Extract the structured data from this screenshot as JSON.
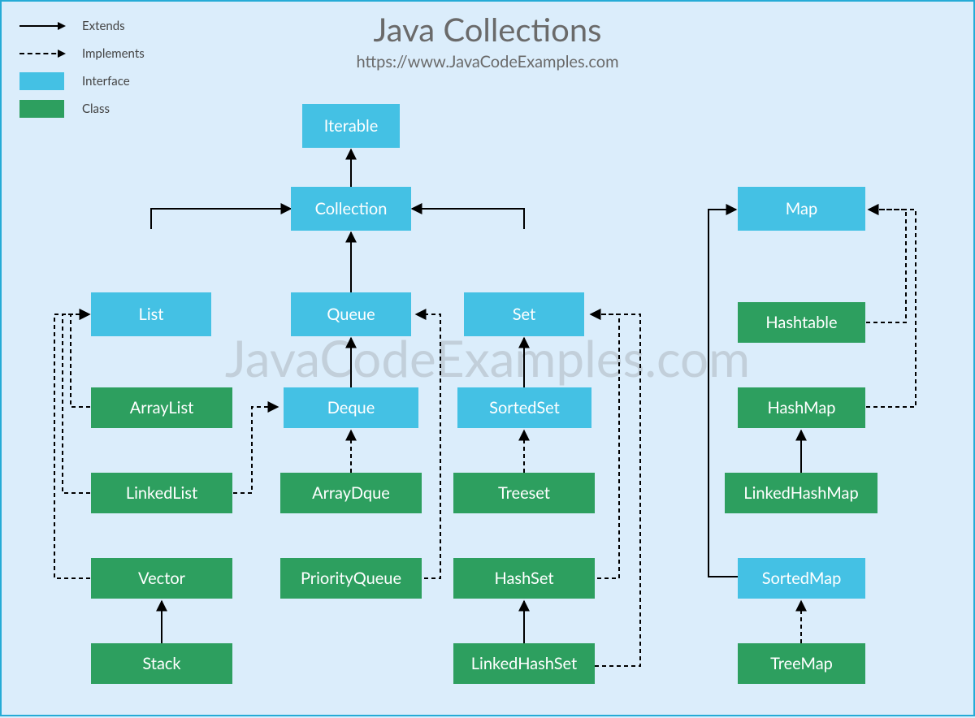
{
  "title": "Java Collections",
  "subtitle": "https://www.JavaCodeExamples.com",
  "watermark": "JavaCodeExamples.com",
  "legend": {
    "extends": "Extends",
    "implements": "Implements",
    "interface": "Interface",
    "class": "Class"
  },
  "colors": {
    "interface": "#44c1e4",
    "class": "#2d9f5f",
    "background": "#dbedfb",
    "border": "#25abd6"
  },
  "nodes": {
    "iterable": {
      "label": "Iterable",
      "kind": "interface"
    },
    "collection": {
      "label": "Collection",
      "kind": "interface"
    },
    "list": {
      "label": "List",
      "kind": "interface"
    },
    "queue": {
      "label": "Queue",
      "kind": "interface"
    },
    "set": {
      "label": "Set",
      "kind": "interface"
    },
    "deque": {
      "label": "Deque",
      "kind": "interface"
    },
    "sortedset": {
      "label": "SortedSet",
      "kind": "interface"
    },
    "arraylist": {
      "label": "ArrayList",
      "kind": "class"
    },
    "linkedlist": {
      "label": "LinkedList",
      "kind": "class"
    },
    "vector": {
      "label": "Vector",
      "kind": "class"
    },
    "stack": {
      "label": "Stack",
      "kind": "class"
    },
    "arraydque": {
      "label": "ArrayDque",
      "kind": "class"
    },
    "priorityqueue": {
      "label": "PriorityQueue",
      "kind": "class"
    },
    "treeset": {
      "label": "Treeset",
      "kind": "class"
    },
    "hashset": {
      "label": "HashSet",
      "kind": "class"
    },
    "linkedhashset": {
      "label": "LinkedHashSet",
      "kind": "class"
    },
    "map": {
      "label": "Map",
      "kind": "interface"
    },
    "hashtable": {
      "label": "Hashtable",
      "kind": "class"
    },
    "hashmap": {
      "label": "HashMap",
      "kind": "class"
    },
    "linkedhashmap": {
      "label": "LinkedHashMap",
      "kind": "class"
    },
    "sortedmap": {
      "label": "SortedMap",
      "kind": "interface"
    },
    "treemap": {
      "label": "TreeMap",
      "kind": "class"
    }
  },
  "edges": [
    {
      "from": "collection",
      "to": "iterable",
      "rel": "extends"
    },
    {
      "from": "list",
      "to": "collection",
      "rel": "extends"
    },
    {
      "from": "queue",
      "to": "collection",
      "rel": "extends"
    },
    {
      "from": "set",
      "to": "collection",
      "rel": "extends"
    },
    {
      "from": "deque",
      "to": "queue",
      "rel": "extends"
    },
    {
      "from": "sortedset",
      "to": "set",
      "rel": "extends"
    },
    {
      "from": "arraylist",
      "to": "list",
      "rel": "implements"
    },
    {
      "from": "linkedlist",
      "to": "list",
      "rel": "implements"
    },
    {
      "from": "linkedlist",
      "to": "deque",
      "rel": "implements"
    },
    {
      "from": "vector",
      "to": "list",
      "rel": "implements"
    },
    {
      "from": "stack",
      "to": "vector",
      "rel": "extends"
    },
    {
      "from": "arraydque",
      "to": "deque",
      "rel": "implements"
    },
    {
      "from": "priorityqueue",
      "to": "queue",
      "rel": "implements"
    },
    {
      "from": "treeset",
      "to": "sortedset",
      "rel": "implements"
    },
    {
      "from": "hashset",
      "to": "set",
      "rel": "implements"
    },
    {
      "from": "linkedhashset",
      "to": "hashset",
      "rel": "extends"
    },
    {
      "from": "linkedhashset",
      "to": "set",
      "rel": "implements"
    },
    {
      "from": "hashtable",
      "to": "map",
      "rel": "implements"
    },
    {
      "from": "hashmap",
      "to": "map",
      "rel": "implements"
    },
    {
      "from": "linkedhashmap",
      "to": "hashmap",
      "rel": "extends"
    },
    {
      "from": "sortedmap",
      "to": "map",
      "rel": "extends"
    },
    {
      "from": "treemap",
      "to": "sortedmap",
      "rel": "implements"
    }
  ]
}
